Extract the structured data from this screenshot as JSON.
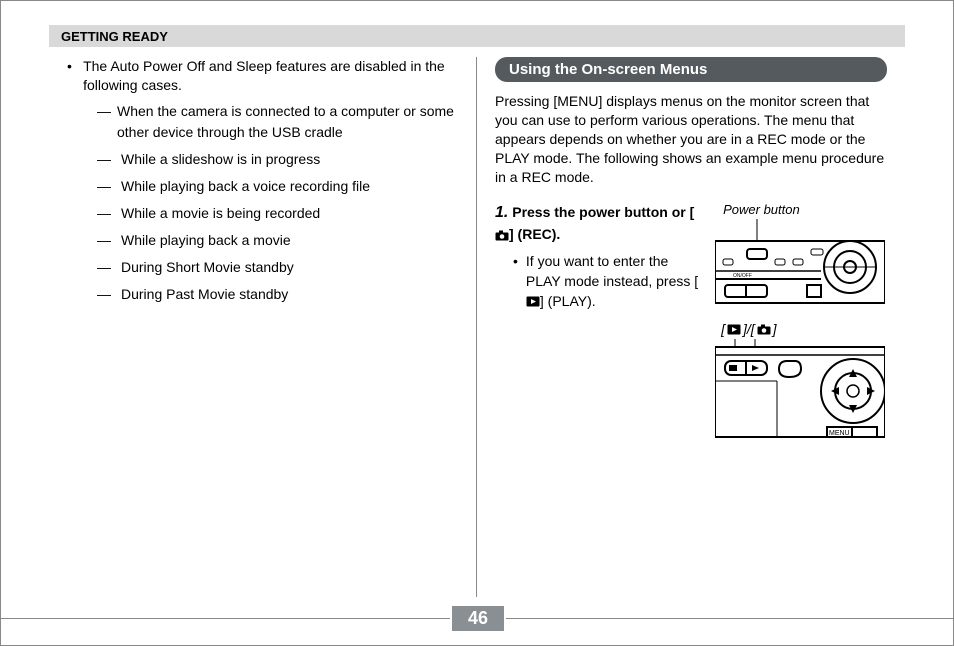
{
  "header": {
    "section": "GETTING READY"
  },
  "left": {
    "intro": "The Auto Power Off and Sleep features are disabled in the following cases.",
    "cases": [
      "When the camera is connected to a computer or some other device through the USB cradle",
      "While a slideshow is in progress",
      "While playing back a voice recording file",
      "While a movie is being recorded",
      "While playing back a movie",
      "During Short Movie standby",
      "During Past Movie standby"
    ]
  },
  "right": {
    "title": "Using the On-screen Menus",
    "intro": "Pressing [MENU] displays menus on the monitor screen that you can use to perform various operations. The menu that appears depends on whether you are in a REC mode or the PLAY mode. The following shows an example menu procedure in a REC mode.",
    "step_num": "1.",
    "step_before": "Press the power button or [",
    "step_after": "] (REC).",
    "sub_before": "If you want to enter the PLAY mode instead, press [",
    "sub_after": "] (PLAY).",
    "caption": "Power button",
    "mode_label_open": "[",
    "mode_label_mid": "]/[",
    "mode_label_close": "]"
  },
  "page_number": "46"
}
